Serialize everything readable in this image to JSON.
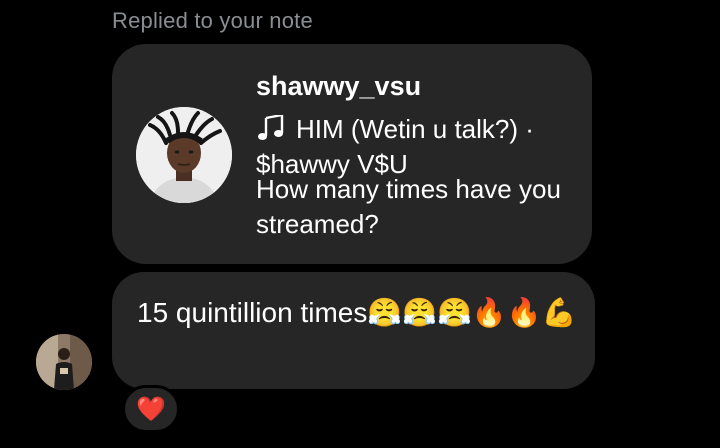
{
  "header": {
    "replied_label": "Replied to your note"
  },
  "note": {
    "username": "shawwy_vsu",
    "song": "HIM (Wetin u talk?) · $hawwy V$U",
    "question": "How many times have you streamed?",
    "music_icon": "music-note-icon"
  },
  "reply": {
    "text": "15 quintillion times😤😤😤🔥🔥💪"
  },
  "reaction": {
    "emoji": "❤️",
    "color": "#ff3040"
  },
  "theme": {
    "background": "#000000",
    "bubble": "#262626",
    "muted_text": "#8a8d91",
    "text": "#ffffff"
  }
}
